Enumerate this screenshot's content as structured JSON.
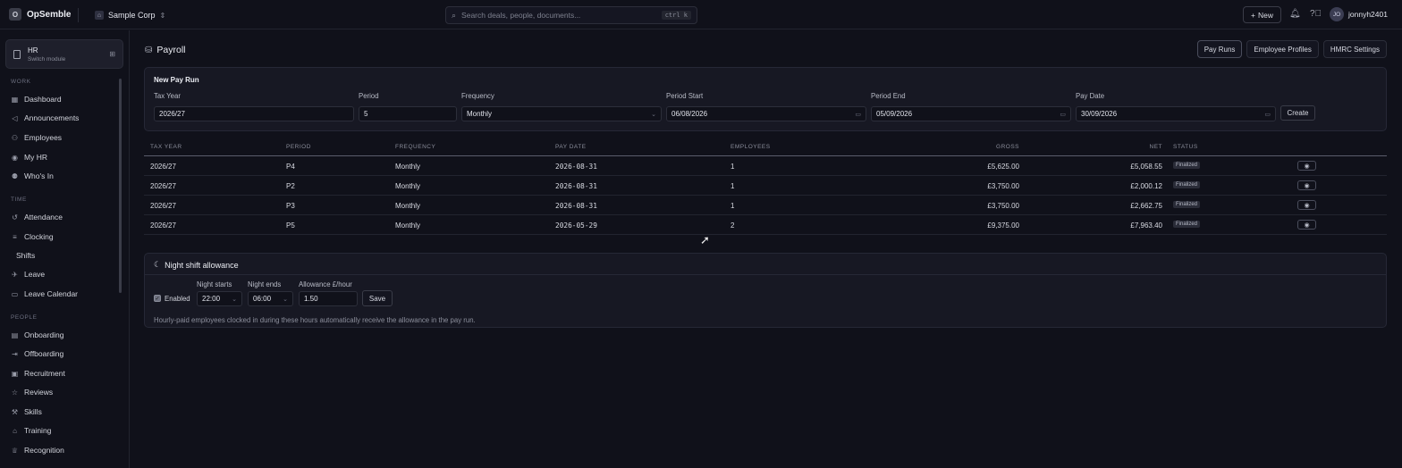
{
  "app": {
    "brand_letter": "O",
    "brand_name": "OpSemble",
    "org_name": "Sample Corp",
    "search_placeholder": "Search deals, people, documents...",
    "search_kbd": "ctrl k",
    "new_label": "New",
    "user_initials": "JO",
    "username": "jonnyh2401"
  },
  "sidebar": {
    "module_title": "HR",
    "module_sub": "Switch module",
    "sections": [
      {
        "label": "WORK",
        "items": [
          "Dashboard",
          "Announcements",
          "Employees",
          "My HR",
          "Who's In"
        ]
      },
      {
        "label": "TIME",
        "items": [
          "Attendance",
          "Clocking",
          "Shifts",
          "Leave",
          "Leave Calendar"
        ]
      },
      {
        "label": "PEOPLE",
        "items": [
          "Onboarding",
          "Offboarding",
          "Recruitment",
          "Reviews",
          "Skills",
          "Training",
          "Recognition"
        ]
      }
    ]
  },
  "page": {
    "title": "Payroll",
    "tabs": [
      "Pay Runs",
      "Employee Profiles",
      "HMRC Settings"
    ]
  },
  "new_pay_run": {
    "title": "New Pay Run",
    "tax_year_label": "Tax Year",
    "tax_year": "2026/27",
    "period_label": "Period",
    "period": "5",
    "frequency_label": "Frequency",
    "frequency": "Monthly",
    "period_start_label": "Period Start",
    "period_start": "06/08/2026",
    "period_end_label": "Period End",
    "period_end": "05/09/2026",
    "pay_date_label": "Pay Date",
    "pay_date": "30/09/2026",
    "create_label": "Create"
  },
  "table": {
    "headers": [
      "TAX YEAR",
      "PERIOD",
      "FREQUENCY",
      "PAY DATE",
      "EMPLOYEES",
      "GROSS",
      "NET",
      "STATUS"
    ],
    "rows": [
      {
        "tax_year": "2026/27",
        "period": "P4",
        "frequency": "Monthly",
        "pay_date": "2026-08-31",
        "employees": "1",
        "gross": "£5,625.00",
        "net": "£5,058.55",
        "status": "Finalized"
      },
      {
        "tax_year": "2026/27",
        "period": "P2",
        "frequency": "Monthly",
        "pay_date": "2026-08-31",
        "employees": "1",
        "gross": "£3,750.00",
        "net": "£2,000.12",
        "status": "Finalized"
      },
      {
        "tax_year": "2026/27",
        "period": "P3",
        "frequency": "Monthly",
        "pay_date": "2026-08-31",
        "employees": "1",
        "gross": "£3,750.00",
        "net": "£2,662.75",
        "status": "Finalized"
      },
      {
        "tax_year": "2026/27",
        "period": "P5",
        "frequency": "Monthly",
        "pay_date": "2026-05-29",
        "employees": "2",
        "gross": "£9,375.00",
        "net": "£7,963.40",
        "status": "Finalized"
      }
    ]
  },
  "night_shift": {
    "title": "Night shift allowance",
    "enabled_label": "Enabled",
    "enabled": true,
    "starts_label": "Night starts",
    "starts": "22:00",
    "ends_label": "Night ends",
    "ends": "06:00",
    "allowance_label": "Allowance £/hour",
    "allowance": "1.50",
    "save_label": "Save",
    "hint": "Hourly-paid employees clocked in during these hours automatically receive the allowance in the pay run."
  },
  "icons": {
    "search": "search-icon",
    "bell": "bell-icon",
    "help": "help-icon",
    "eye": "eye-icon",
    "moon": "moon-icon"
  }
}
